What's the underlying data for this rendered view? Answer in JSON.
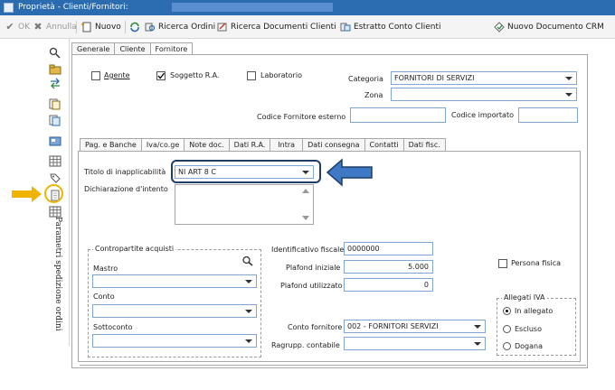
{
  "window": {
    "title": "Proprietà - Clienti/Fornitori:"
  },
  "toolbar": {
    "ok": "OK",
    "annulla": "Annulla",
    "nuovo": "Nuovo",
    "ricerca_ordini": "Ricerca Ordini",
    "ricerca_documenti": "Ricerca Documenti Clienti",
    "estratto_conto": "Estratto Conto Clienti",
    "nuovo_documento_crm": "Nuovo Documento CRM"
  },
  "sidebar": {
    "vertical_label": "Parametri spedizione ordini"
  },
  "tabs_top": [
    "Generale",
    "Cliente",
    "Fornitore"
  ],
  "tabs_top_active": "Fornitore",
  "header": {
    "agente": "Agente",
    "soggetto_ra": "Soggetto R.A.",
    "laboratorio": "Laboratorio",
    "categoria_label": "Categoria",
    "categoria_value": "FORNITORI DI SERVIZI",
    "zona_label": "Zona",
    "zona_value": "",
    "codice_fornitore_esterno_label": "Codice Fornitore esterno",
    "codice_fornitore_esterno_value": "",
    "codice_importato_label": "Codice importato",
    "codice_importato_value": ""
  },
  "checks": {
    "agente": false,
    "soggetto_ra": true,
    "laboratorio": false,
    "persona_fisica": false
  },
  "tabs_inner": [
    "Pag. e Banche",
    "Iva/co.ge",
    "Note doc.",
    "Dati R.A.",
    "Intra",
    "Dati consegna",
    "Contatti",
    "Dati fisc."
  ],
  "tabs_inner_active": "Iva/co.ge",
  "iva": {
    "titolo_label": "Titolo di inapplicabilità",
    "titolo_value": "NI ART 8 C",
    "dichiarazione_label": "Dichiarazione d'intento"
  },
  "contropartite": {
    "title": "Contropartite acquisti",
    "mastro": "Mastro",
    "conto": "Conto",
    "sottoconto": "Sottoconto"
  },
  "fiscale": {
    "identificativo_label": "Identificativo fiscale",
    "identificativo_value": "0000000",
    "plafond_iniziale_label": "Plafond iniziale",
    "plafond_iniziale_value": "5.000",
    "plafond_utilizzato_label": "Plafond utilizzato",
    "plafond_utilizzato_value": "0",
    "persona_fisica": "Persona fisica",
    "conto_fornitore_label": "Conto fornitore",
    "conto_fornitore_value": "002 - FORNITORI SERVIZI",
    "ragrupp_label": "Ragrupp. contabile",
    "ragrupp_value": ""
  },
  "allegati": {
    "title": "Allegati IVA",
    "options": [
      "In allegato",
      "Escluso",
      "Dogana"
    ],
    "selected": "In allegato"
  },
  "colors": {
    "titlebar": "#2b6cb0",
    "callout": "#1f3d66",
    "callout_arrow": "#3f78c4",
    "highlight": "#f0b400"
  }
}
